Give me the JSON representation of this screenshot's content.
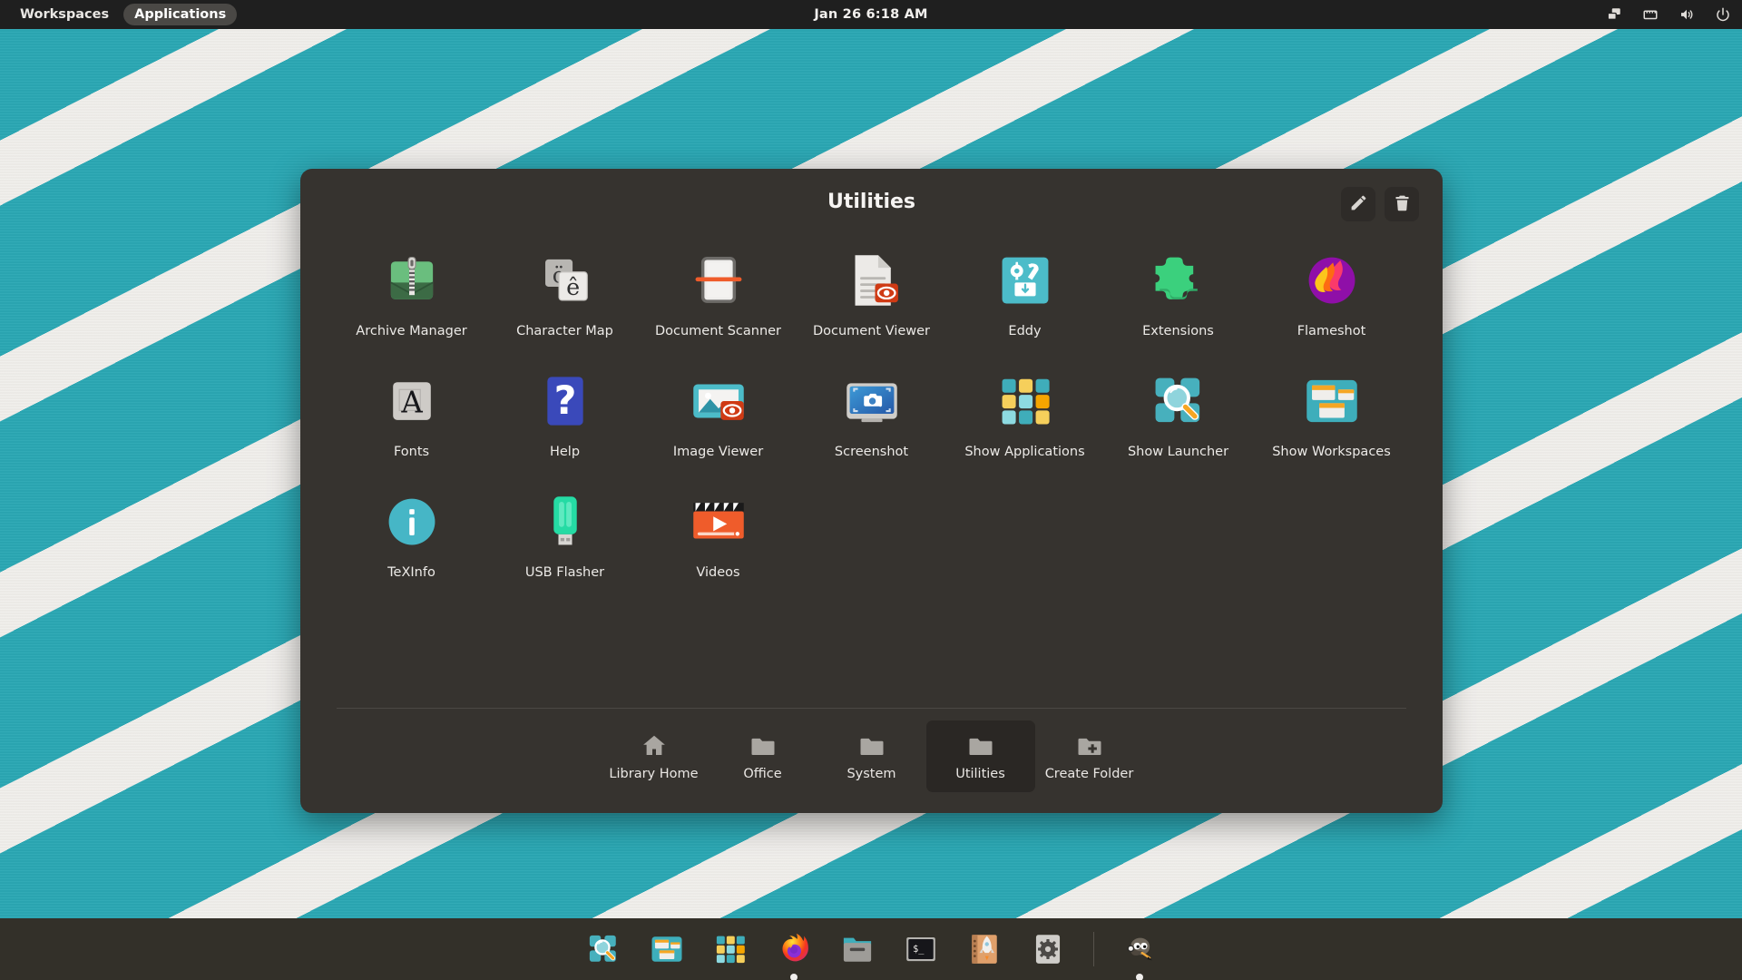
{
  "topbar": {
    "workspaces_label": "Workspaces",
    "applications_label": "Applications",
    "clock": "Jan 26  6:18 AM",
    "tray": [
      {
        "name": "display-windows-icon"
      },
      {
        "name": "network-ethernet-icon"
      },
      {
        "name": "volume-icon"
      },
      {
        "name": "power-icon"
      }
    ]
  },
  "folder_panel": {
    "title": "Utilities",
    "actions": [
      {
        "name": "edit-folder-button",
        "icon": "pencil-icon"
      },
      {
        "name": "delete-folder-button",
        "icon": "trash-icon"
      }
    ],
    "apps": [
      {
        "label": "Archive Manager",
        "icon": "archive-manager-icon"
      },
      {
        "label": "Character Map",
        "icon": "character-map-icon"
      },
      {
        "label": "Document Scanner",
        "icon": "document-scanner-icon"
      },
      {
        "label": "Document Viewer",
        "icon": "document-viewer-icon"
      },
      {
        "label": "Eddy",
        "icon": "eddy-icon"
      },
      {
        "label": "Extensions",
        "icon": "extensions-icon"
      },
      {
        "label": "Flameshot",
        "icon": "flameshot-icon"
      },
      {
        "label": "Fonts",
        "icon": "fonts-icon"
      },
      {
        "label": "Help",
        "icon": "help-icon"
      },
      {
        "label": "Image Viewer",
        "icon": "image-viewer-icon"
      },
      {
        "label": "Screenshot",
        "icon": "screenshot-icon"
      },
      {
        "label": "Show Applications",
        "icon": "show-applications-icon"
      },
      {
        "label": "Show Launcher",
        "icon": "show-launcher-icon"
      },
      {
        "label": "Show Workspaces",
        "icon": "show-workspaces-icon"
      },
      {
        "label": "TeXInfo",
        "icon": "texinfo-icon"
      },
      {
        "label": "USB Flasher",
        "icon": "usb-flasher-icon"
      },
      {
        "label": "Videos",
        "icon": "videos-icon"
      }
    ],
    "tabs": [
      {
        "label": "Library Home",
        "icon": "home-icon",
        "selected": false
      },
      {
        "label": "Office",
        "icon": "folder-icon",
        "selected": false
      },
      {
        "label": "System",
        "icon": "folder-icon",
        "selected": false
      },
      {
        "label": "Utilities",
        "icon": "folder-icon",
        "selected": true
      },
      {
        "label": "Create Folder",
        "icon": "folder-add-icon",
        "selected": false
      }
    ]
  },
  "dock": {
    "items": [
      {
        "name": "show-launcher-icon",
        "running": false
      },
      {
        "name": "show-workspaces-icon",
        "running": false
      },
      {
        "name": "show-applications-icon",
        "running": false
      },
      {
        "name": "firefox-icon",
        "running": true
      },
      {
        "name": "files-icon",
        "running": false
      },
      {
        "name": "terminal-icon",
        "running": false
      },
      {
        "name": "launcher-rocket-icon",
        "running": false
      },
      {
        "name": "settings-icon",
        "running": false
      },
      {
        "name": "gimp-icon",
        "running": true
      }
    ]
  },
  "colors": {
    "desktop_teal": "#2ba8b4",
    "desktop_stripe": "#f1efec",
    "panel_bg": "#36332f",
    "dock_bg": "#333029",
    "topbar_bg": "#1f1f1f"
  }
}
